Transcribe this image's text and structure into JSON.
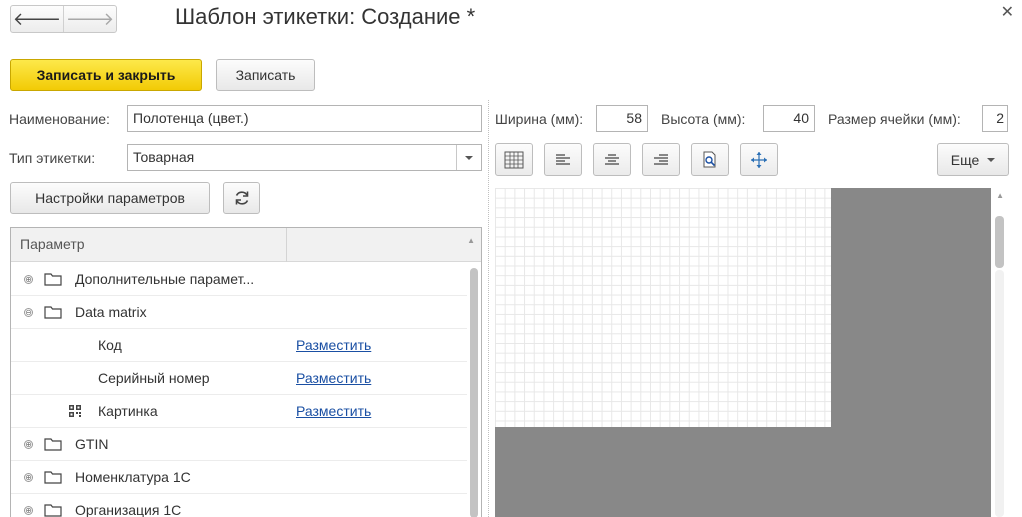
{
  "window": {
    "title": "Шаблон этикетки: Создание *",
    "close_icon": "close-icon",
    "nav_back_icon": "arrow-left-icon",
    "nav_forward_icon": "arrow-right-icon"
  },
  "toolbar": {
    "save_close_label": "Записать и закрыть",
    "save_label": "Записать"
  },
  "form": {
    "name_label": "Наименование:",
    "name_value": "Полотенца (цвет.)",
    "type_label": "Тип этикетки:",
    "type_value": "Товарная",
    "params_settings_label": "Настройки параметров",
    "refresh_icon": "refresh-icon"
  },
  "size": {
    "width_label": "Ширина (мм):",
    "width_value": "58",
    "height_label": "Высота (мм):",
    "height_value": "40",
    "cell_label": "Размер ячейки (мм):",
    "cell_value": "2"
  },
  "tools": {
    "icons": [
      "barcode-table-icon",
      "align-left-icon",
      "align-center-icon",
      "align-right-icon",
      "preview-icon",
      "move-icon"
    ],
    "more_label": "Еще"
  },
  "tree": {
    "column_header": "Параметр",
    "rows": [
      {
        "label": "Дополнительные парамет...",
        "expander": "⊕",
        "icon": "folder-icon",
        "link": ""
      },
      {
        "label": "Data matrix",
        "expander": "⊖",
        "icon": "folder-icon",
        "link": ""
      },
      {
        "label": "Код",
        "expander": "",
        "icon": "",
        "link": "Разместить"
      },
      {
        "label": "Серийный номер",
        "expander": "",
        "icon": "",
        "link": "Разместить"
      },
      {
        "label": "Картинка",
        "expander": "",
        "icon": "qr-code-icon",
        "link": "Разместить"
      },
      {
        "label": "GTIN",
        "expander": "⊕",
        "icon": "folder-icon",
        "link": ""
      },
      {
        "label": "Номенклатура 1С",
        "expander": "⊕",
        "icon": "folder-icon",
        "link": ""
      },
      {
        "label": "Организация 1С",
        "expander": "⊕",
        "icon": "folder-icon",
        "link": ""
      }
    ]
  },
  "colors": {
    "primary_button": "#f5d31a",
    "link": "#1a4fa3",
    "canvas_background": "#888888"
  }
}
